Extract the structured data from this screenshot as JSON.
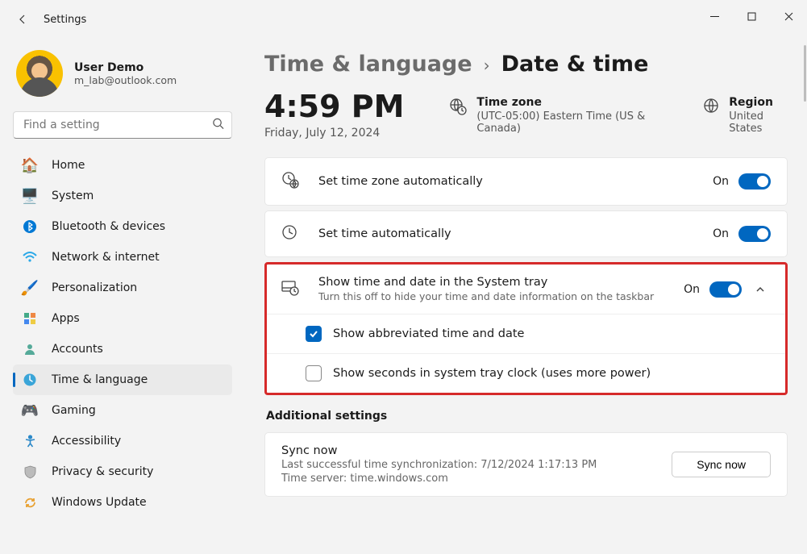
{
  "titlebar": {
    "title": "Settings"
  },
  "profile": {
    "name": "User Demo",
    "email": "m_lab@outlook.com"
  },
  "search": {
    "placeholder": "Find a setting"
  },
  "sidebar": {
    "items": [
      {
        "label": "Home",
        "icon": "home"
      },
      {
        "label": "System",
        "icon": "system"
      },
      {
        "label": "Bluetooth & devices",
        "icon": "bluetooth"
      },
      {
        "label": "Network & internet",
        "icon": "wifi"
      },
      {
        "label": "Personalization",
        "icon": "personalization"
      },
      {
        "label": "Apps",
        "icon": "apps"
      },
      {
        "label": "Accounts",
        "icon": "accounts"
      },
      {
        "label": "Time & language",
        "icon": "time"
      },
      {
        "label": "Gaming",
        "icon": "gaming"
      },
      {
        "label": "Accessibility",
        "icon": "accessibility"
      },
      {
        "label": "Privacy & security",
        "icon": "privacy"
      },
      {
        "label": "Windows Update",
        "icon": "update"
      }
    ],
    "selected_index": 7
  },
  "breadcrumb": {
    "parent": "Time & language",
    "current": "Date & time"
  },
  "clock": {
    "time": "4:59 PM",
    "date": "Friday, July 12, 2024"
  },
  "tz": {
    "label": "Time zone",
    "value": "(UTC-05:00) Eastern Time (US & Canada)"
  },
  "region": {
    "label": "Region",
    "value": "United States"
  },
  "rows": {
    "auto_tz": {
      "label": "Set time zone automatically",
      "state": "On"
    },
    "auto_time": {
      "label": "Set time automatically",
      "state": "On"
    },
    "tray": {
      "label": "Show time and date in the System tray",
      "desc": "Turn this off to hide your time and date information on the taskbar",
      "state": "On",
      "sub_abbrev": "Show abbreviated time and date",
      "sub_seconds": "Show seconds in system tray clock (uses more power)"
    }
  },
  "additional": {
    "heading": "Additional settings",
    "sync_title": "Sync now",
    "sync_last": "Last successful time synchronization: 7/12/2024 1:17:13 PM",
    "sync_server": "Time server: time.windows.com",
    "sync_btn": "Sync now"
  }
}
